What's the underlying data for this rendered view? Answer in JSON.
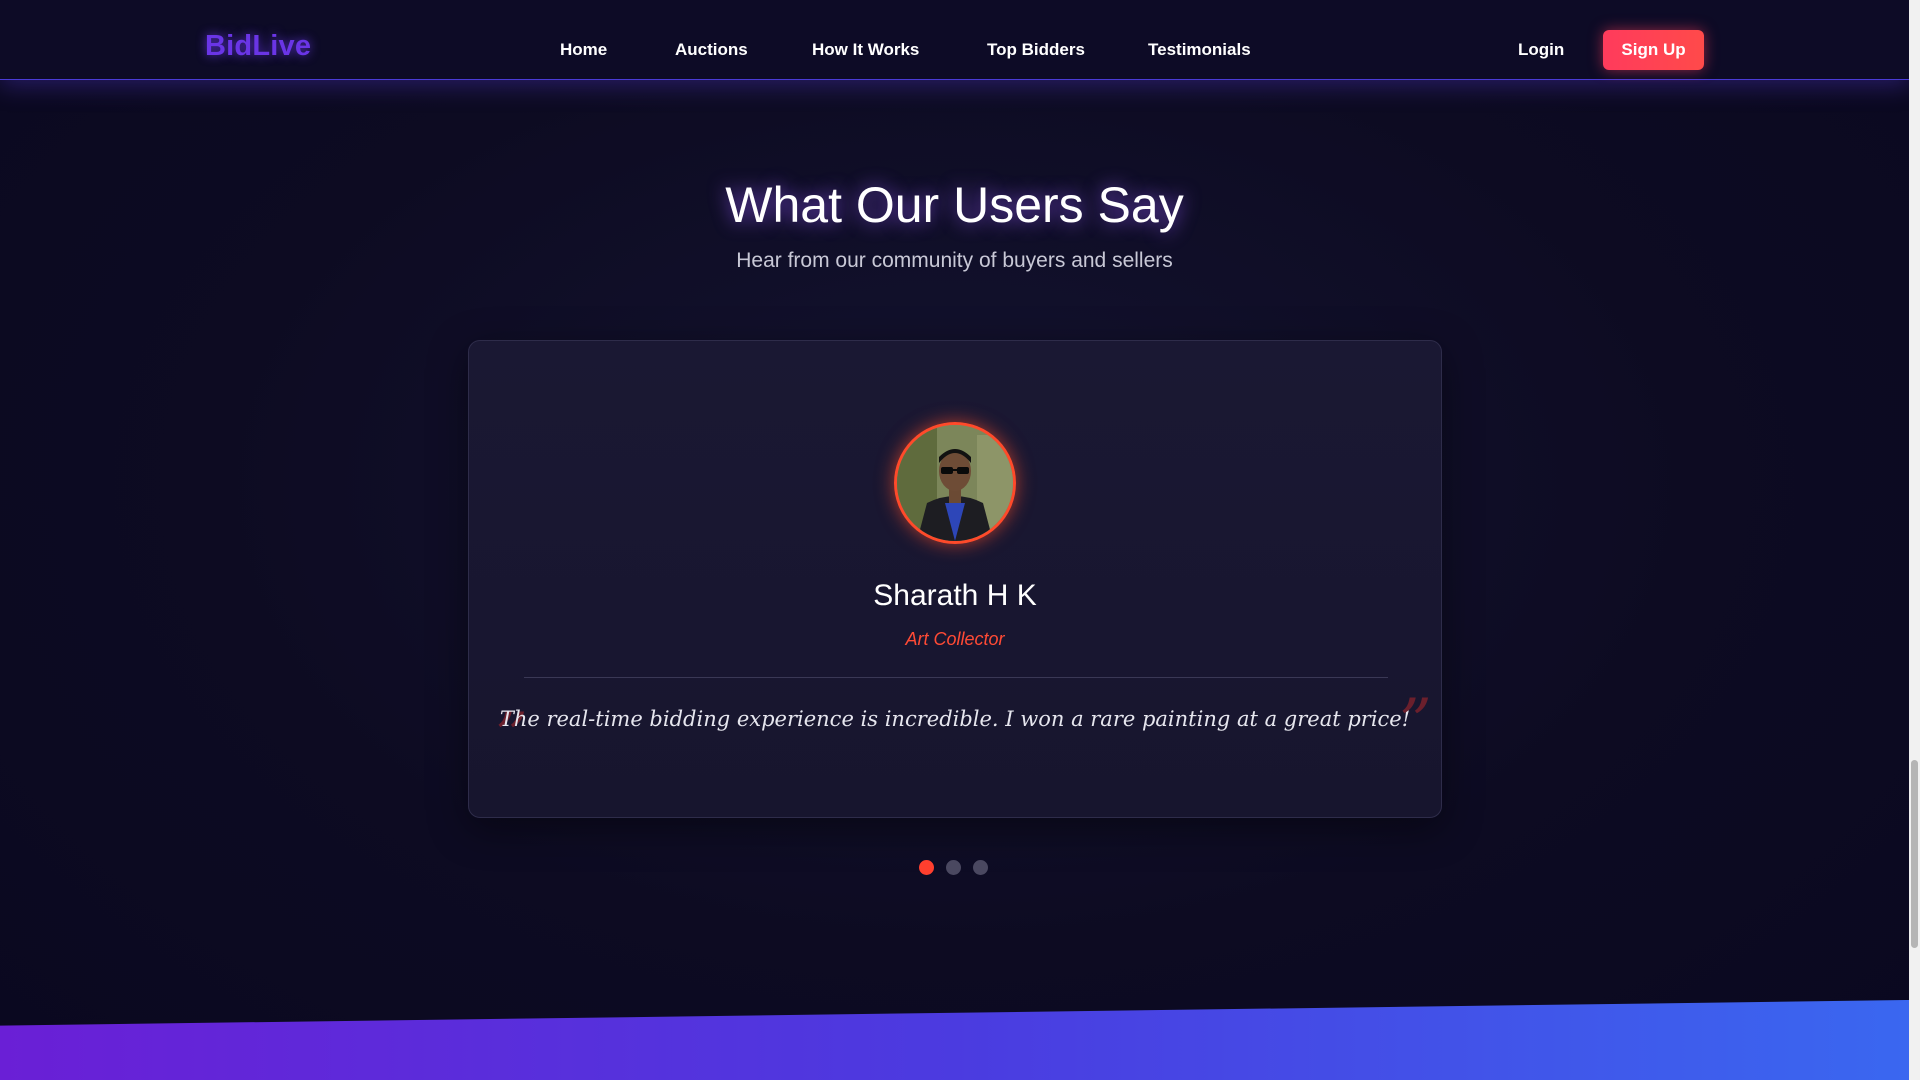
{
  "brand": {
    "logo": "BidLive"
  },
  "nav": {
    "links": [
      "Home",
      "Auctions",
      "How It Works",
      "Top Bidders",
      "Testimonials"
    ],
    "login": "Login",
    "signup": "Sign Up"
  },
  "section": {
    "title": "What Our Users Say",
    "subtitle": "Hear from our community of buyers and sellers"
  },
  "testimonial": {
    "name": "Sharath H K",
    "role": "Art Collector",
    "quote": "The real-time bidding experience is incredible. I won a rare painting at a great price!",
    "open_mark": "”",
    "close_mark": "”"
  },
  "carousel": {
    "total_slides": 3,
    "active_slide": 1
  },
  "colors": {
    "accent": "#ff3f2e",
    "brand": "#6a35e6",
    "background": "#0c0a20"
  },
  "icons": {
    "avatar": "user-photo-avatar",
    "quote": "quote-mark-icon"
  }
}
